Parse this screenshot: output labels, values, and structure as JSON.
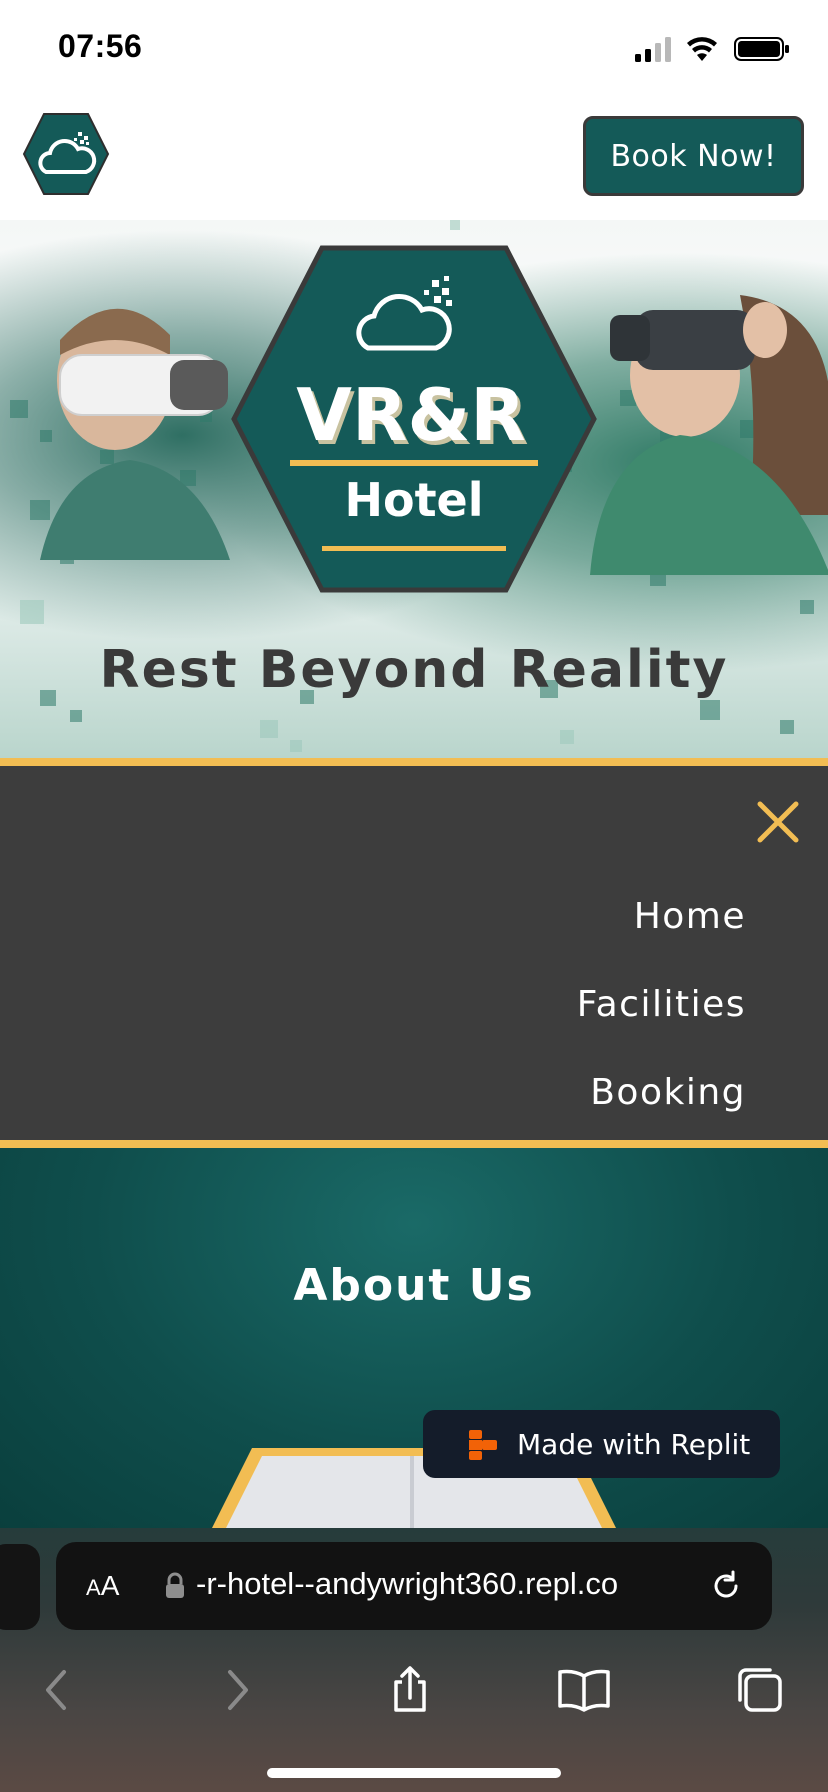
{
  "status_bar": {
    "time": "07:56"
  },
  "header": {
    "book_button_label": "Book Now!"
  },
  "hero": {
    "logo_line1": "VR&R",
    "logo_line2": "Hotel",
    "tagline": "Rest Beyond Reality"
  },
  "nav": {
    "items": [
      {
        "label": "Home"
      },
      {
        "label": "Facilities"
      },
      {
        "label": "Booking"
      }
    ]
  },
  "about": {
    "title": "About Us"
  },
  "replit_badge": {
    "label": "Made with Replit"
  },
  "browser": {
    "aa_small": "A",
    "aa_large": "A",
    "url": "-r-hotel--andywright360.repl.co"
  },
  "colors": {
    "teal": "#145a58",
    "gold": "#f2bd53",
    "dark_grey": "#3d3d3d",
    "replit_orange": "#f26207"
  },
  "icons": {
    "logo": "cloud-hexagon-icon",
    "close": "close-icon",
    "lock": "lock-icon",
    "reload": "reload-icon",
    "back": "chevron-left-icon",
    "forward": "chevron-right-icon",
    "share": "share-icon",
    "bookmarks": "book-icon",
    "tabs": "tabs-icon"
  }
}
